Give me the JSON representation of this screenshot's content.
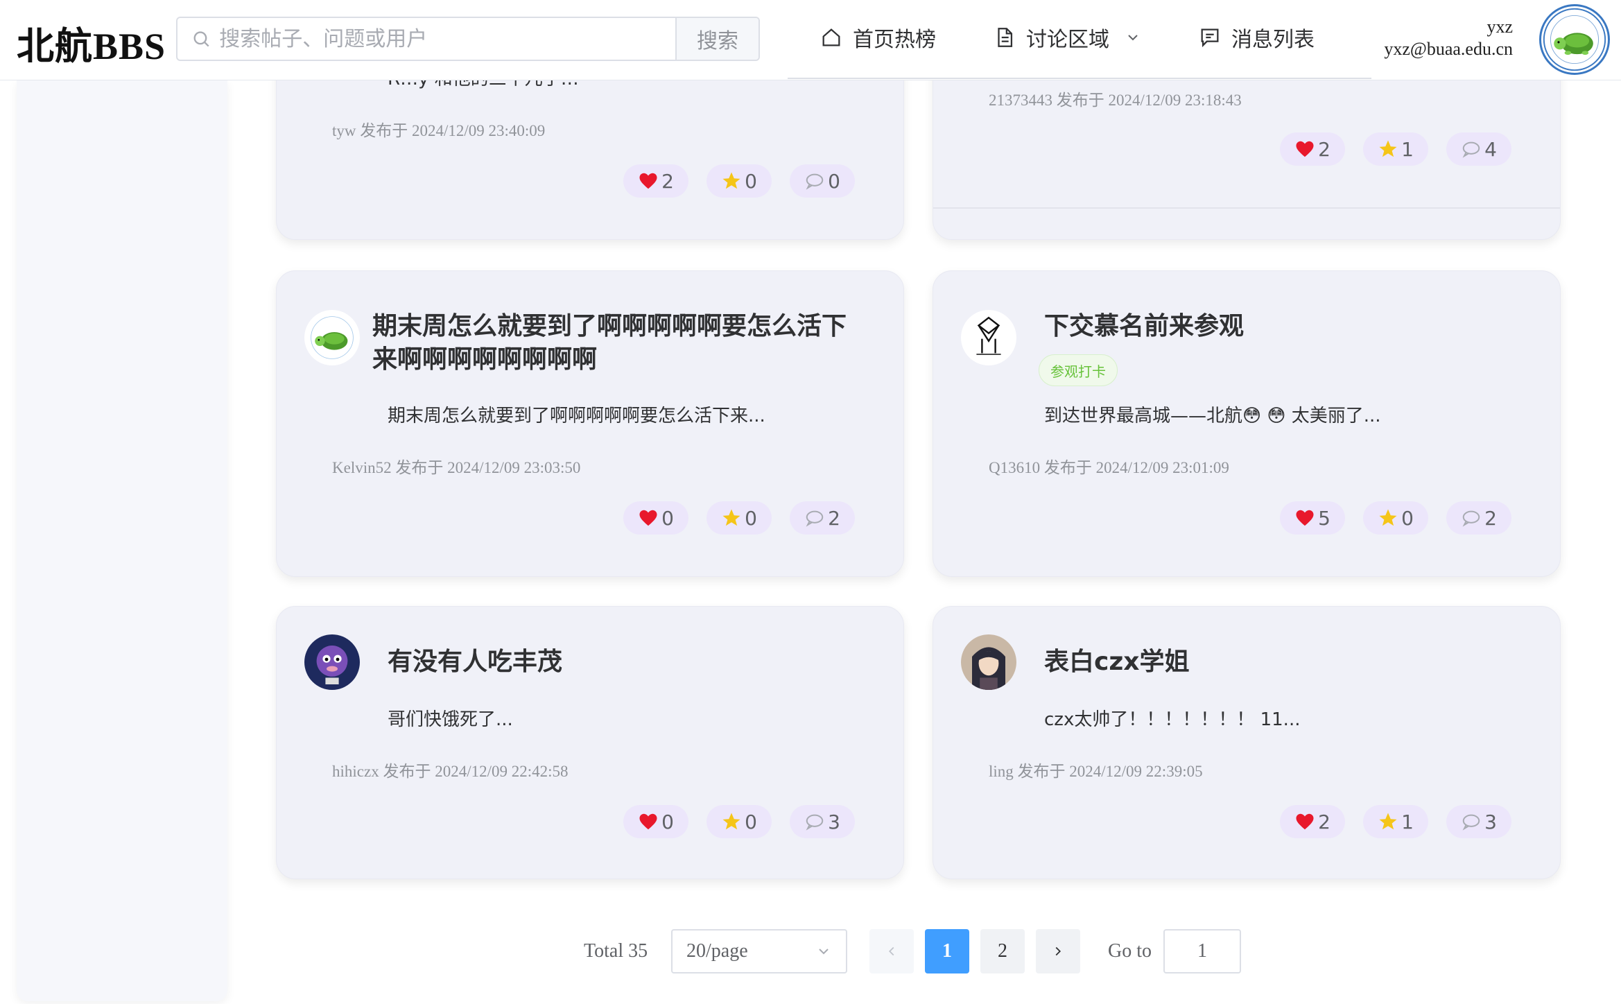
{
  "header": {
    "logo": "北航",
    "logo_en": "BBS",
    "search_placeholder": "搜索帖子、问题或用户",
    "search_button": "搜索",
    "nav": [
      {
        "label": "首页热榜",
        "icon": "home-icon"
      },
      {
        "label": "讨论区域",
        "icon": "document-icon"
      },
      {
        "label": "消息列表",
        "icon": "message-icon"
      }
    ],
    "user_name": "yxz",
    "user_email": "yxz@buaa.edu.cn"
  },
  "posts": [
    {
      "author_meta": "tyw 发布于 2024/12/09 23:40:09",
      "excerpt_partial": "R…y 和他的三个儿子…",
      "likes": "2",
      "stars": "0",
      "comments": "0"
    },
    {
      "author_meta": "21373443 发布于 2024/12/09 23:18:43",
      "likes": "2",
      "stars": "1",
      "comments": "4"
    },
    {
      "title": "期末周怎么就要到了啊啊啊啊啊要怎么活下来啊啊啊啊啊啊啊啊",
      "excerpt": "期末周怎么就要到了啊啊啊啊啊要怎么活下来...",
      "author_meta": "Kelvin52 发布于 2024/12/09 23:03:50",
      "likes": "0",
      "stars": "0",
      "comments": "2"
    },
    {
      "title": "下交慕名前来参观",
      "tag": "参观打卡",
      "excerpt": "到达世界最高城——北航😳 😳 太美丽了...",
      "author_meta": "Q13610 发布于 2024/12/09 23:01:09",
      "likes": "5",
      "stars": "0",
      "comments": "2"
    },
    {
      "title": "有没有人吃丰茂",
      "excerpt": "哥们快饿死了...",
      "author_meta": "hihiczx 发布于 2024/12/09 22:42:58",
      "likes": "0",
      "stars": "0",
      "comments": "3"
    },
    {
      "title": "表白czx学姐",
      "excerpt": "czx太帅了！！！！！！！ 11...",
      "author_meta": "ling 发布于 2024/12/09 22:39:05",
      "likes": "2",
      "stars": "1",
      "comments": "3"
    }
  ],
  "pagination": {
    "total": "Total 35",
    "page_size": "20/page",
    "pages": [
      "1",
      "2"
    ],
    "current": "1",
    "goto_label": "Go to",
    "goto_value": "1"
  },
  "colors": {
    "accent": "#409eff",
    "card_bg": "#f0f1f8",
    "pill_bg": "#ece6fb",
    "heart": "#e8182c",
    "star": "#f5c518",
    "tag_green": "#67c23a"
  }
}
